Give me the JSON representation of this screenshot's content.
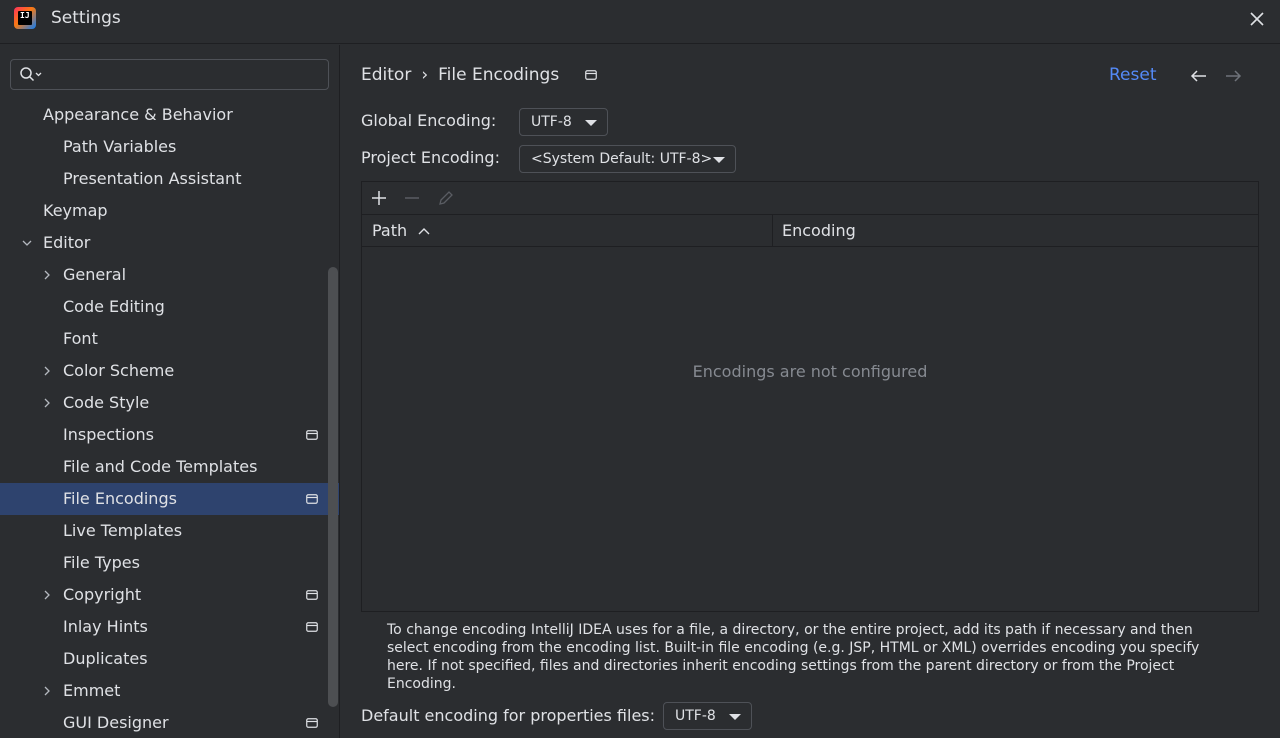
{
  "window": {
    "title": "Settings"
  },
  "search": {
    "placeholder": "",
    "value": ""
  },
  "sidebar": {
    "items": [
      {
        "label": "Appearance & Behavior",
        "level": 0,
        "expander": "none",
        "bold": true
      },
      {
        "label": "Path Variables",
        "level": 1,
        "expander": "none"
      },
      {
        "label": "Presentation Assistant",
        "level": 1,
        "expander": "none"
      },
      {
        "label": "Keymap",
        "level": 0,
        "expander": "none"
      },
      {
        "label": "Editor",
        "level": 0,
        "expander": "expanded"
      },
      {
        "label": "General",
        "level": 1,
        "expander": "collapsed"
      },
      {
        "label": "Code Editing",
        "level": 1,
        "expander": "none"
      },
      {
        "label": "Font",
        "level": 1,
        "expander": "none"
      },
      {
        "label": "Color Scheme",
        "level": 1,
        "expander": "collapsed"
      },
      {
        "label": "Code Style",
        "level": 1,
        "expander": "collapsed"
      },
      {
        "label": "Inspections",
        "level": 1,
        "expander": "none",
        "project_icon": true
      },
      {
        "label": "File and Code Templates",
        "level": 1,
        "expander": "none"
      },
      {
        "label": "File Encodings",
        "level": 1,
        "expander": "none",
        "project_icon": true,
        "selected": true
      },
      {
        "label": "Live Templates",
        "level": 1,
        "expander": "none"
      },
      {
        "label": "File Types",
        "level": 1,
        "expander": "none"
      },
      {
        "label": "Copyright",
        "level": 1,
        "expander": "collapsed",
        "project_icon": true
      },
      {
        "label": "Inlay Hints",
        "level": 1,
        "expander": "none",
        "project_icon": true
      },
      {
        "label": "Duplicates",
        "level": 1,
        "expander": "none"
      },
      {
        "label": "Emmet",
        "level": 1,
        "expander": "collapsed"
      },
      {
        "label": "GUI Designer",
        "level": 1,
        "expander": "none",
        "project_icon": true
      }
    ]
  },
  "breadcrumb": {
    "parent": "Editor",
    "separator": "›",
    "current": "File Encodings"
  },
  "header_actions": {
    "reset_label": "Reset"
  },
  "global_encoding": {
    "label": "Global Encoding:",
    "value": "UTF-8"
  },
  "project_encoding": {
    "label": "Project Encoding:",
    "value": "<System Default: UTF-8>"
  },
  "table": {
    "columns": [
      "Path",
      "Encoding"
    ],
    "sorted_column": "Path",
    "sort_direction": "ascending",
    "empty_text": "Encodings are not configured",
    "rows": []
  },
  "help_text": "To change encoding IntelliJ IDEA uses for a file, a directory, or the entire project, add its path if necessary and then select encoding from the encoding list. Built-in file encoding (e.g. JSP, HTML or XML) overrides encoding you specify here. If not specified, files and directories inherit encoding settings from the parent directory or from the Project Encoding.",
  "properties_encoding": {
    "label": "Default encoding for properties files:",
    "value": "UTF-8"
  },
  "colors": {
    "background": "#2b2d30",
    "selection": "#2e436e",
    "link": "#548af7",
    "muted_text": "#868a91",
    "text": "#dfe1e5"
  },
  "icons": [
    "app-logo-icon",
    "close-icon",
    "search-icon",
    "chevron-down-icon",
    "chevron-right-icon",
    "project-level-icon",
    "arrow-left-icon",
    "arrow-right-icon",
    "plus-icon",
    "minus-icon",
    "edit-pencil-icon",
    "sort-ascending-icon",
    "dropdown-arrow-icon"
  ]
}
